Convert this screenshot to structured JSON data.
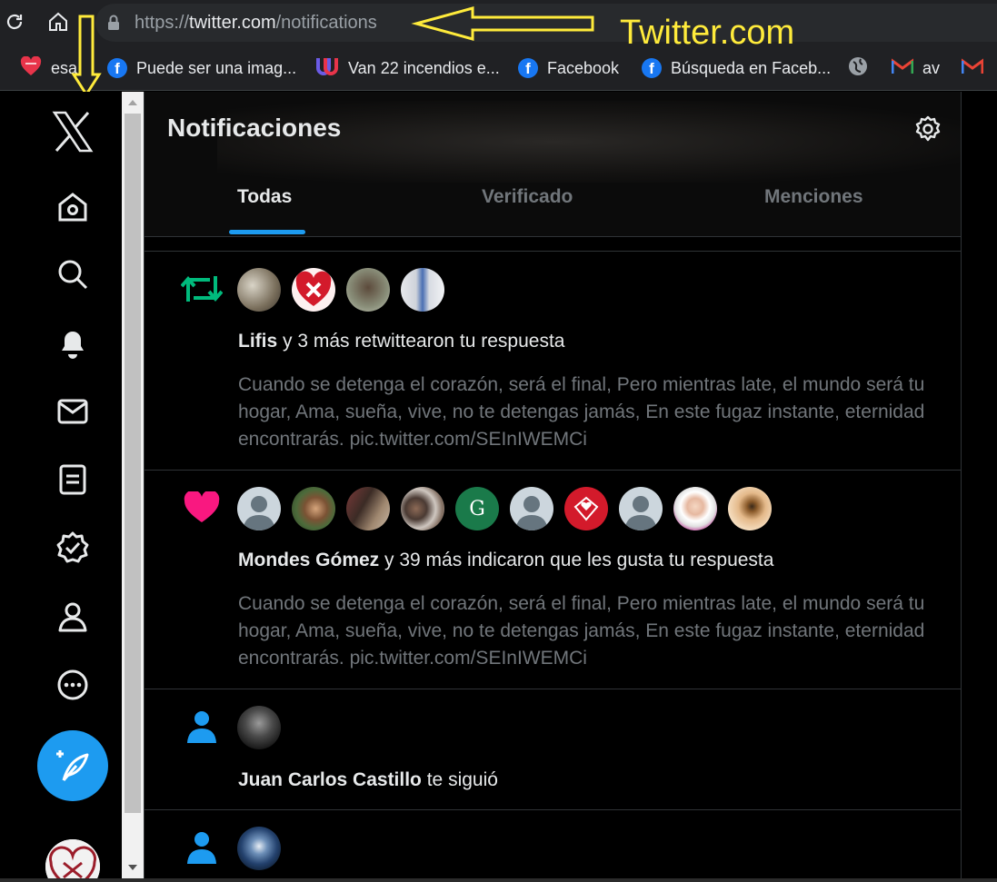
{
  "browser": {
    "url_scheme": "https://",
    "url_host": "twitter.com",
    "url_path": "/notifications",
    "annotation_label": "Twitter.com",
    "bookmarks": [
      {
        "label": "esa",
        "icon": "heart-icon"
      },
      {
        "label": "Puede ser una imag...",
        "icon": "facebook-icon"
      },
      {
        "label": "Van 22 incendios e...",
        "icon": "univision-icon"
      },
      {
        "label": "Facebook",
        "icon": "facebook-icon"
      },
      {
        "label": "Búsqueda en Faceb...",
        "icon": "facebook-icon"
      },
      {
        "label": "",
        "icon": "globe-icon"
      },
      {
        "label": "av",
        "icon": "gmail-icon"
      },
      {
        "label": "",
        "icon": "gmail-icon"
      }
    ]
  },
  "nav": {
    "items": [
      "x-logo-icon",
      "home-icon",
      "search-icon",
      "bell-icon",
      "mail-icon",
      "lists-icon",
      "verified-icon",
      "profile-icon",
      "more-icon"
    ],
    "compose_icon": "compose-icon"
  },
  "header": {
    "title": "Notificaciones",
    "tabs": [
      {
        "label": "Todas",
        "active": true
      },
      {
        "label": "Verificado",
        "active": false
      },
      {
        "label": "Menciones",
        "active": false
      }
    ]
  },
  "notifications": [
    {
      "type": "retweet",
      "icon": "retweet-icon",
      "icon_color": "#00ba7c",
      "avatar_count": 4,
      "name": "Lifis",
      "action": " y 3 más retwittearon tu respuesta",
      "body": "Cuando se detenga el corazón, será el final, Pero mientras late, el mundo será tu hogar, Ama, sueña, vive, no te detengas jamás, En este fugaz instante, eternidad encontrarás. pic.twitter.com/SEInIWEMCi"
    },
    {
      "type": "like",
      "icon": "heart-icon",
      "icon_color": "#f91880",
      "avatar_count": 10,
      "avatar_letter": "G",
      "name": "Mondes Gómez",
      "action": " y 39 más indicaron que les gusta tu respuesta",
      "body": "Cuando se detenga el corazón, será el final, Pero mientras late, el mundo será tu hogar, Ama, sueña, vive, no te detengas jamás, En este fugaz instante, eternidad encontrarás. pic.twitter.com/SEInIWEMCi"
    },
    {
      "type": "follow",
      "icon": "person-icon",
      "icon_color": "#1d9bf0",
      "avatar_count": 1,
      "name": "Juan Carlos Castillo",
      "action": " te siguió"
    },
    {
      "type": "follow",
      "icon": "person-icon",
      "icon_color": "#1d9bf0",
      "avatar_count": 1
    }
  ],
  "colors": {
    "accent": "#1d9bf0",
    "annotation": "#ffeb3b",
    "background": "#000000"
  }
}
